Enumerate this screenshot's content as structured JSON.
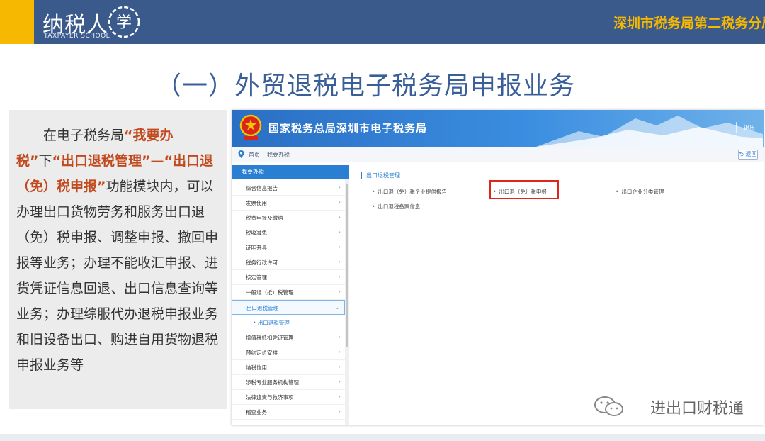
{
  "header": {
    "logo_text": "纳税人",
    "logo_mark_char": "学",
    "logo_sub": "TAXPAYER SCHOOL",
    "org": "深圳市税务局第二税务分局",
    "accent_color": "#f6b800",
    "bar_color": "#3a5a8c"
  },
  "slide": {
    "title": "（一）外贸退税电子税务局申报业务"
  },
  "text_panel": {
    "p1": "在电子税务局",
    "hl1": "“我要办税”",
    "p2": "下",
    "hl2": "“出口退税管理”—“出口退（免）税申报”",
    "p3": "功能模块内，可以办理出口货物劳务和服务出口退（免）税申报、调整申报、撤回申报等业务；办理不能收汇申报、进货凭证信息回退、出口信息查询等业务；办理综服代办退税申报业务和旧设备出口、购进自用货物退税申报业务等"
  },
  "portal": {
    "title": "国家税务总局深圳市电子税务局",
    "exit": "退出",
    "back_label": "返回",
    "breadcrumb": [
      "首页",
      "我要办税"
    ],
    "sidebar_head": "我要办税",
    "sidebar_items": [
      "综合信息报告",
      "发票使用",
      "税费申报及缴纳",
      "税收减免",
      "证明开具",
      "税务行政许可",
      "核定管理",
      "一般退（抵）税管理",
      "出口退税管理"
    ],
    "sidebar_sub": "出口退税管理",
    "sidebar_items_after": [
      "增值税抵扣凭证管理",
      "预约定价安排",
      "纳税信用",
      "涉税专业服务机构管理",
      "法律追责与救济事项",
      "稽查业务"
    ],
    "section_title": "出口退税管理",
    "functions": [
      "出口退（免）税企业提供报告",
      "出口退（免）税申报",
      "出口企业分类管理",
      "出口退税备案信息"
    ]
  },
  "watermark": "进出口财税通",
  "icons": {
    "emblem": "national-emblem-icon",
    "pin": "location-pin-icon",
    "wechat": "wechat-icon"
  }
}
